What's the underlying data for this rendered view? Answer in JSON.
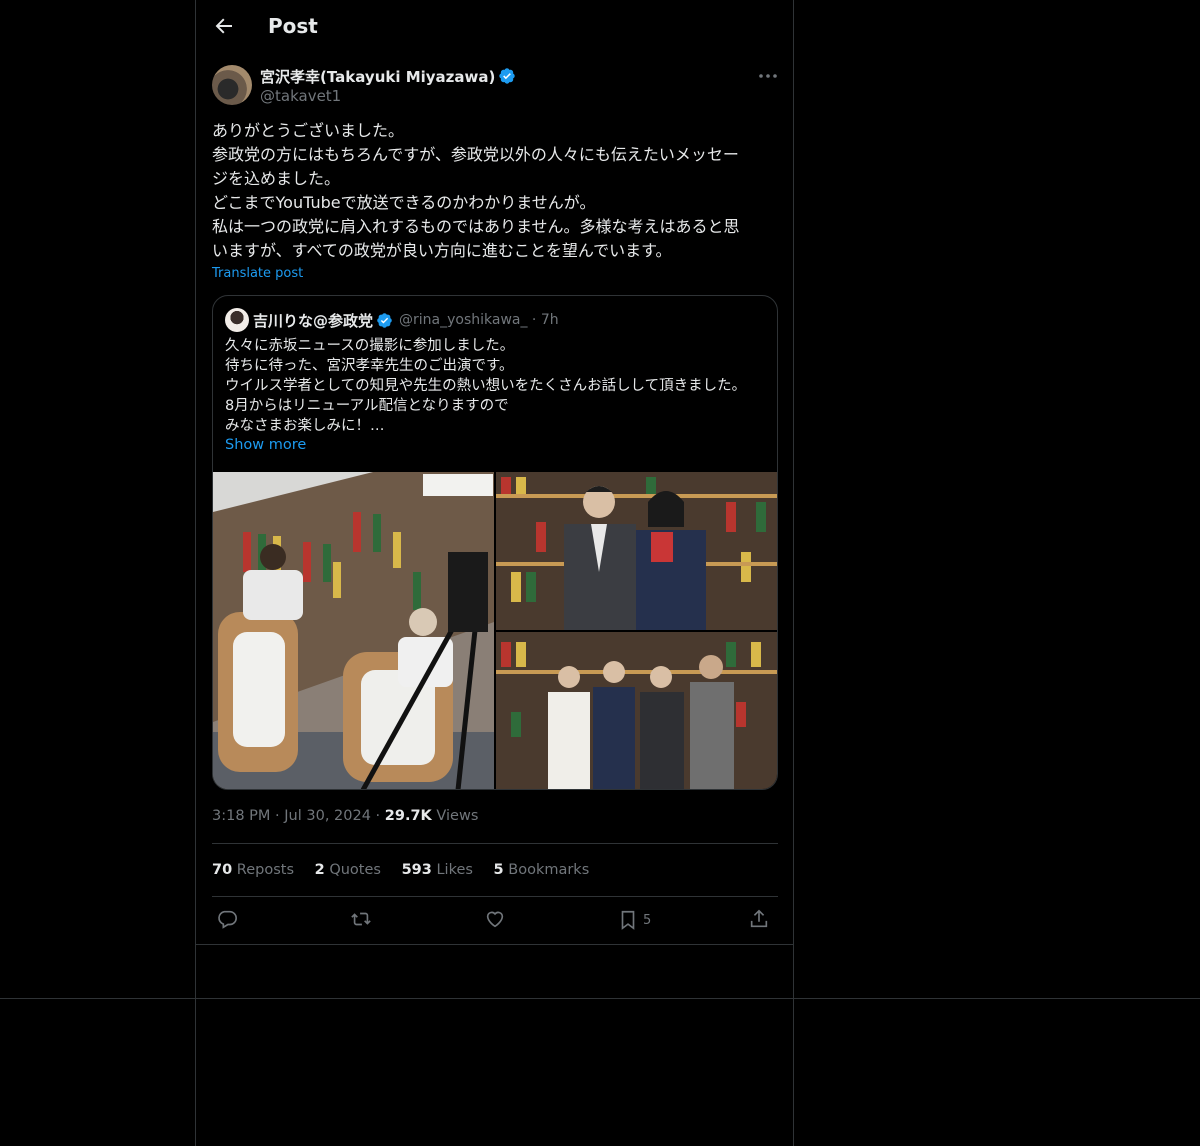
{
  "header": {
    "title": "Post"
  },
  "author": {
    "name": "宮沢孝幸(Takayuki Miyazawa)",
    "handle": "@takavet1"
  },
  "post": {
    "text": "ありがとうございました。\n参政党の方にはもちろんですが、参政党以外の人々にも伝えたいメッセー\nジを込めました。\nどこまでYouTubeで放送できるのかわかりませんが。\n私は一つの政党に肩入れするものではありません。多様な考えはあると思\nいますが、すべての政党が良い方向に進むことを望んでいます。",
    "translate_label": "Translate post",
    "time": "3:18 PM",
    "date": "Jul 30, 2024",
    "views_count": "29.7K",
    "views_label": "Views"
  },
  "quote": {
    "name": "吉川りな@参政党",
    "handle": "@rina_yoshikawa_",
    "age": "7h",
    "text": "久々に赤坂ニュースの撮影に参加しました。\n待ちに待った、宮沢孝幸先生のご出演です。\nウイルス学者としての知見や先生の熱い想いをたくさんお話しして頂きました。\n8月からはリニューアル配信となりますので\nみなさまお楽しみに！…",
    "show_more": "Show more"
  },
  "stats": {
    "reposts_count": "70",
    "reposts_label": "Reposts",
    "quotes_count": "2",
    "quotes_label": "Quotes",
    "likes_count": "593",
    "likes_label": "Likes",
    "bookmarks_count": "5",
    "bookmarks_label": "Bookmarks"
  },
  "actions": {
    "bookmark_count": "5"
  },
  "colors": {
    "accent": "#1d9bf0",
    "background": "#000000",
    "border": "#2f3336",
    "muted": "#71767b"
  }
}
